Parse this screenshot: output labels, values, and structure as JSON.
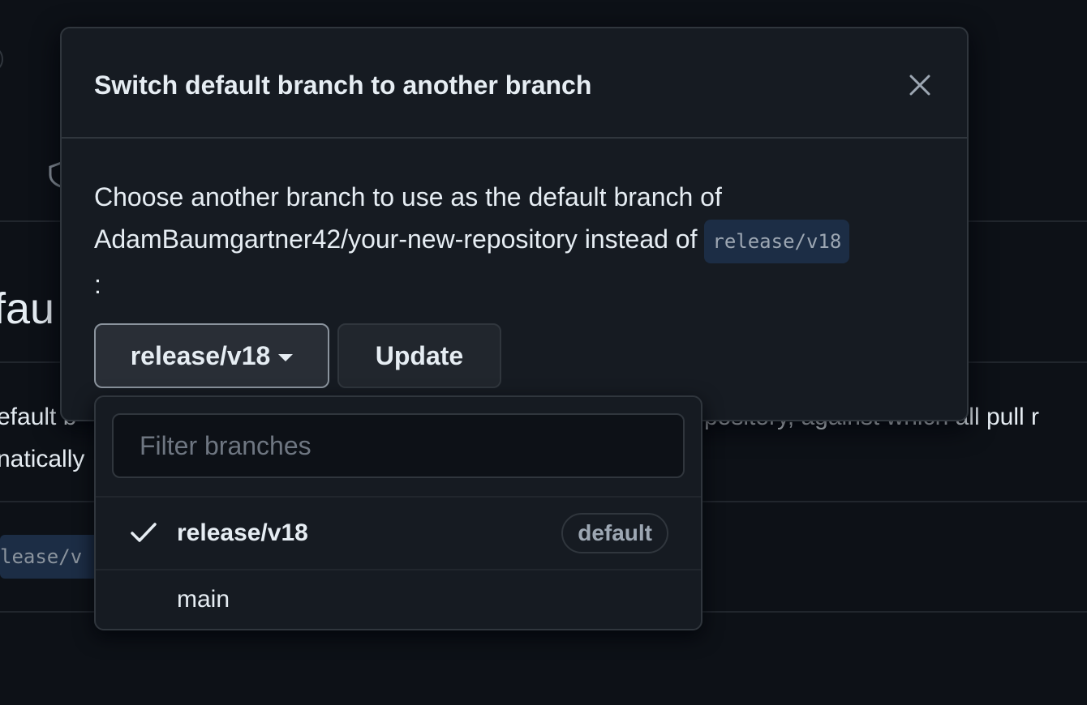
{
  "background": {
    "heading_fragment": "fau",
    "text_line1_left": "efault b",
    "text_line1_right": "pository, against which all pull r",
    "text_line2_left": "natically",
    "code_fragment": "lease/v"
  },
  "modal": {
    "title": "Switch default branch to another branch",
    "desc_part1": "Choose another branch to use as the default branch of AdamBaumgartner42/your-new-repository instead of ",
    "desc_code": "release/v18",
    "desc_part2": ":",
    "branch_button_label": "release/v18",
    "update_button_label": "Update"
  },
  "dropdown": {
    "filter_placeholder": "Filter branches",
    "items": [
      {
        "label": "release/v18",
        "selected": true,
        "badge": "default"
      },
      {
        "label": "main",
        "selected": false
      }
    ]
  },
  "colors": {
    "background": "#0d1117",
    "panel": "#161b22",
    "border": "#30363d",
    "code_bg": "#1c2d45"
  }
}
